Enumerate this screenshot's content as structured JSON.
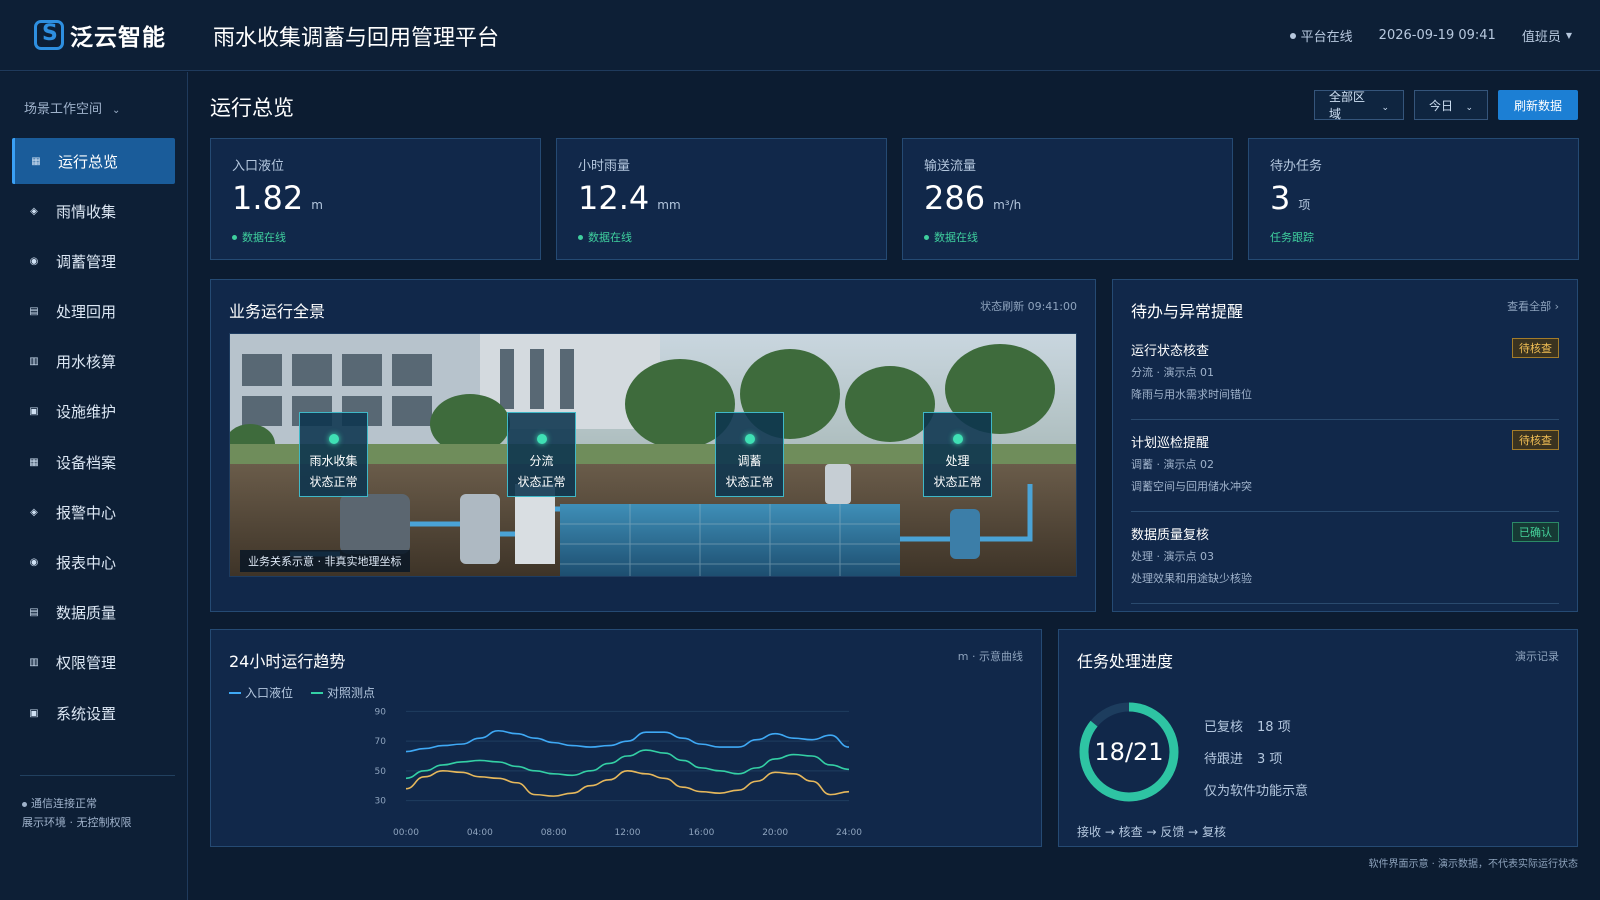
{
  "header": {
    "logo_text": "泛云智能",
    "title": "雨水收集调蓄与回用管理平台",
    "status": "平台在线",
    "datetime": "2026-09-19 09:41",
    "user": "值班员"
  },
  "sidebar": {
    "workspace": "场景工作空间",
    "items": [
      {
        "label": "运行总览",
        "icon": "grid-icon",
        "active": true
      },
      {
        "label": "雨情收集",
        "icon": "diamond-icon"
      },
      {
        "label": "调蓄管理",
        "icon": "target-icon"
      },
      {
        "label": "处理回用",
        "icon": "list-icon"
      },
      {
        "label": "用水核算",
        "icon": "table-icon"
      },
      {
        "label": "设施维护",
        "icon": "square-icon"
      },
      {
        "label": "设备档案",
        "icon": "grid-icon"
      },
      {
        "label": "报警中心",
        "icon": "diamond-icon"
      },
      {
        "label": "报表中心",
        "icon": "target-icon"
      },
      {
        "label": "数据质量",
        "icon": "list-icon"
      },
      {
        "label": "权限管理",
        "icon": "table-icon"
      },
      {
        "label": "系统设置",
        "icon": "square-icon"
      }
    ],
    "footer_status": "通信连接正常",
    "footer_note": "展示环境 · 无控制权限"
  },
  "page": {
    "title": "运行总览",
    "region_select": "全部区域",
    "range_select": "今日",
    "refresh_button": "刷新数据"
  },
  "kpis": [
    {
      "label": "入口液位",
      "value": "1.82",
      "unit": "m",
      "foot": "数据在线"
    },
    {
      "label": "小时雨量",
      "value": "12.4",
      "unit": "mm",
      "foot": "数据在线"
    },
    {
      "label": "输送流量",
      "value": "286",
      "unit": "m³/h",
      "foot": "数据在线"
    },
    {
      "label": "待办任务",
      "value": "3",
      "unit": "项",
      "foot": "任务跟踪"
    }
  ],
  "overview": {
    "title": "业务运行全景",
    "meta": "状态刷新 09:41:00",
    "stages": [
      {
        "name": "雨水收集",
        "status": "状态正常"
      },
      {
        "name": "分流",
        "status": "状态正常"
      },
      {
        "name": "调蓄",
        "status": "状态正常"
      },
      {
        "name": "处理",
        "status": "状态正常"
      }
    ],
    "caption": "业务关系示意 · 非真实地理坐标"
  },
  "alerts": {
    "title": "待办与异常提醒",
    "view_all": "查看全部 ›",
    "items": [
      {
        "title": "运行状态核查",
        "sub": "分流 · 演示点 01",
        "desc": "降雨与用水需求时间错位",
        "badge": "待核查",
        "badge_type": "warn"
      },
      {
        "title": "计划巡检提醒",
        "sub": "调蓄 · 演示点 02",
        "desc": "调蓄空间与回用储水冲突",
        "badge": "待核查",
        "badge_type": "warn"
      },
      {
        "title": "数据质量复核",
        "sub": "处理 · 演示点 03",
        "desc": "处理效果和用途缺少核验",
        "badge": "已确认",
        "badge_type": "ok"
      }
    ]
  },
  "trend": {
    "title": "24小时运行趋势",
    "meta": "m · 示意曲线"
  },
  "chart_data": {
    "type": "line",
    "x": [
      "00:00",
      "01:00",
      "02:00",
      "03:00",
      "04:00",
      "05:00",
      "06:00",
      "07:00",
      "08:00",
      "09:00",
      "10:00",
      "11:00",
      "12:00",
      "13:00",
      "14:00",
      "15:00",
      "16:00",
      "17:00",
      "18:00",
      "19:00",
      "20:00",
      "21:00",
      "22:00",
      "23:00",
      "24:00"
    ],
    "xticks": [
      "00:00",
      "04:00",
      "08:00",
      "12:00",
      "16:00",
      "20:00",
      "24:00"
    ],
    "yticks": [
      90,
      70,
      50,
      30
    ],
    "ylim": [
      25,
      95
    ],
    "series": [
      {
        "name": "入口液位",
        "color": "#3fa9f5",
        "values": [
          63,
          65,
          67,
          68,
          72,
          77,
          75,
          72,
          69,
          67,
          66,
          67,
          70,
          76,
          76,
          72,
          68,
          66,
          66,
          71,
          75,
          72,
          71,
          74,
          66
        ]
      },
      {
        "name": "对照测点",
        "color": "#34d0a5",
        "values": [
          45,
          50,
          54,
          56,
          57,
          56,
          53,
          50,
          48,
          47,
          50,
          55,
          60,
          64,
          62,
          57,
          52,
          50,
          48,
          52,
          58,
          61,
          60,
          54,
          51
        ]
      },
      {
        "name": "",
        "color": "#e6b85c",
        "values": [
          38,
          46,
          50,
          49,
          46,
          45,
          42,
          34,
          33,
          35,
          40,
          44,
          50,
          48,
          45,
          39,
          36,
          35,
          37,
          43,
          49,
          48,
          43,
          34,
          36
        ]
      }
    ]
  },
  "progress": {
    "title": "任务处理进度",
    "meta": "演示记录",
    "done": 18,
    "total": 21,
    "ring_label": "18/21",
    "reviewed_label": "已复核",
    "reviewed_value": "18 项",
    "pending_label": "待跟进",
    "pending_value": "3 项",
    "note": "仅为软件功能示意",
    "flow": "接收 → 核查 → 反馈 → 复核",
    "ring_color": "#2ec4a3",
    "track_color": "#1d3d5e"
  },
  "disclaimer": "软件界面示意 · 演示数据，不代表实际运行状态"
}
